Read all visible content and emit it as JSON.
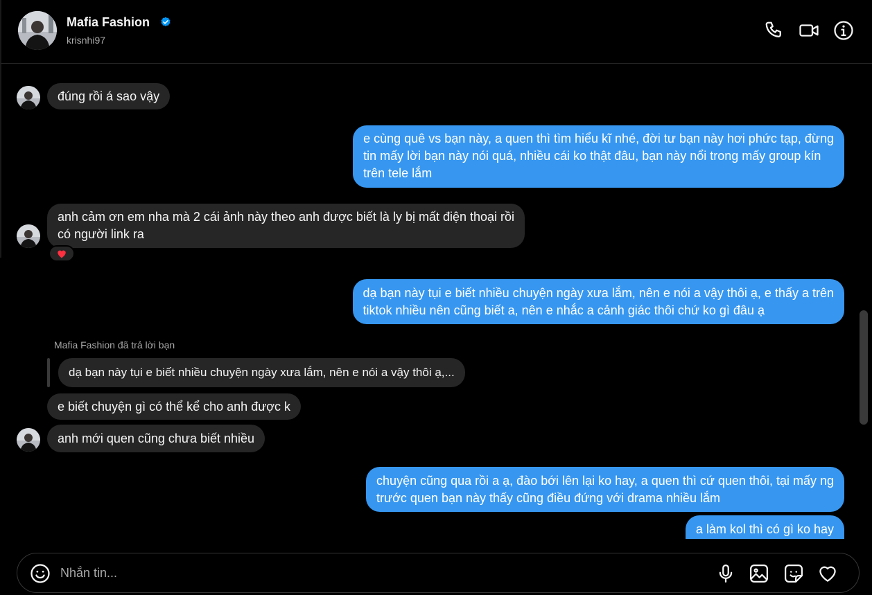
{
  "header": {
    "name": "Mafia Fashion",
    "username": "krisnhi97"
  },
  "messages": {
    "m1": "đúng rồi á sao vậy",
    "m2_l1": "e cùng quê vs bạn này, a quen thì tìm hiểu kĩ nhé, đời tư bạn này hơi phức tạp, đừng",
    "m2_l2": "tin mấy lời bạn này nói quá, nhiều cái ko thật đâu, bạn này nổi trong mấy group kín",
    "m2_l3": "trên tele lắm",
    "m3_l1": "anh cảm ơn em nha mà 2 cái ảnh này theo anh được biết là ly bị mất điện thoại rồi",
    "m3_l2": "có người link ra",
    "m3_reaction": "heart",
    "m4_l1": "dạ bạn này tụi e biết nhiều chuyện ngày xưa lắm, nên e nói a vậy thôi ạ, e thấy a trên",
    "m4_l2": "tiktok nhiều nên cũng biết a, nên e nhắc a cảnh giác thôi chứ ko gì đâu ạ",
    "reply_caption": "Mafia Fashion đã trả lời bạn",
    "quoted": "dạ bạn này tụi e biết nhiều chuyện ngày xưa lắm, nên e nói a vậy thôi ạ,...",
    "m5": "e biết chuyện gì có thể kể cho anh được k",
    "m6": "anh mới quen cũng chưa biết nhiều",
    "m7_l1": "chuyện cũng qua rồi a ạ, đào bới lên lại ko hay, a quen thì cứ quen thôi, tại mấy ng",
    "m7_l2": "trước quen bạn này thấy cũng điều đứng với drama nhiều lắm",
    "m8": "a làm kol thì có gì ko hay"
  },
  "composer": {
    "placeholder": "Nhắn tin..."
  },
  "icons": {
    "header": [
      "phone-icon",
      "video-call-icon",
      "info-icon"
    ],
    "composer": [
      "emoji-icon",
      "microphone-icon",
      "image-icon",
      "sticker-icon",
      "heart-icon"
    ]
  },
  "colors": {
    "outgoing_bubble": "#3797f0",
    "incoming_bubble": "#262626",
    "background": "#000000",
    "verified": "#0095f6",
    "reaction_heart": "#ff3040"
  }
}
